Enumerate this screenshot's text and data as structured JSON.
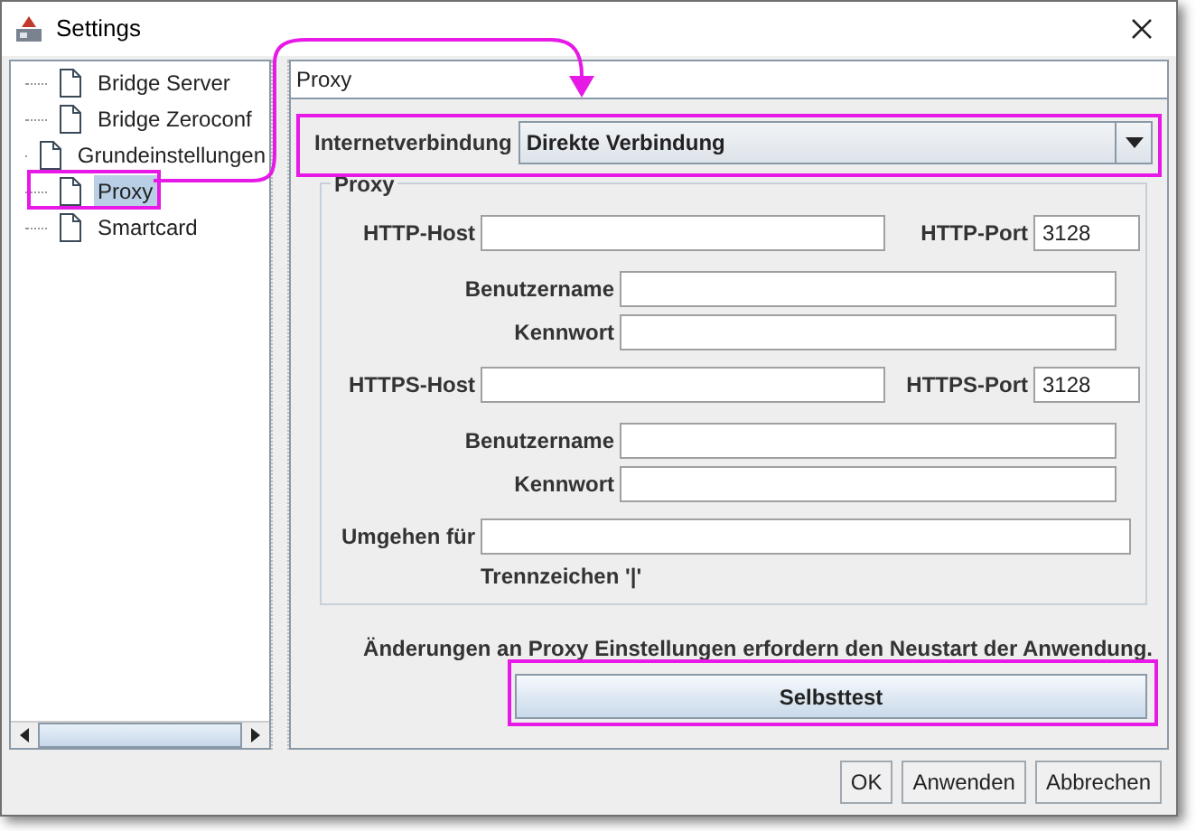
{
  "window": {
    "title": "Settings"
  },
  "tree": {
    "items": [
      {
        "label": "Bridge Server",
        "selected": false
      },
      {
        "label": "Bridge Zeroconf",
        "selected": false
      },
      {
        "label": "Grundeinstellungen",
        "selected": false
      },
      {
        "label": "Proxy",
        "selected": true
      },
      {
        "label": "Smartcard",
        "selected": false
      }
    ]
  },
  "panel": {
    "title": "Proxy",
    "connection": {
      "label": "Internetverbindung",
      "value": "Direkte Verbindung"
    },
    "proxy_group": {
      "title": "Proxy",
      "http": {
        "host_label": "HTTP-Host",
        "port_label": "HTTP-Port",
        "port": "3128",
        "user_label": "Benutzername",
        "pass_label": "Kennwort"
      },
      "https": {
        "host_label": "HTTPS-Host",
        "port_label": "HTTPS-Port",
        "port": "3128",
        "user_label": "Benutzername",
        "pass_label": "Kennwort"
      },
      "bypass_label": "Umgehen für",
      "separator_hint": "Trennzeichen '|'"
    },
    "note": "Änderungen an Proxy Einstellungen erfordern den Neustart der Anwendung.",
    "selftest": "Selbsttest"
  },
  "buttons": [
    "OK",
    "Anwenden",
    "Abbrechen"
  ]
}
